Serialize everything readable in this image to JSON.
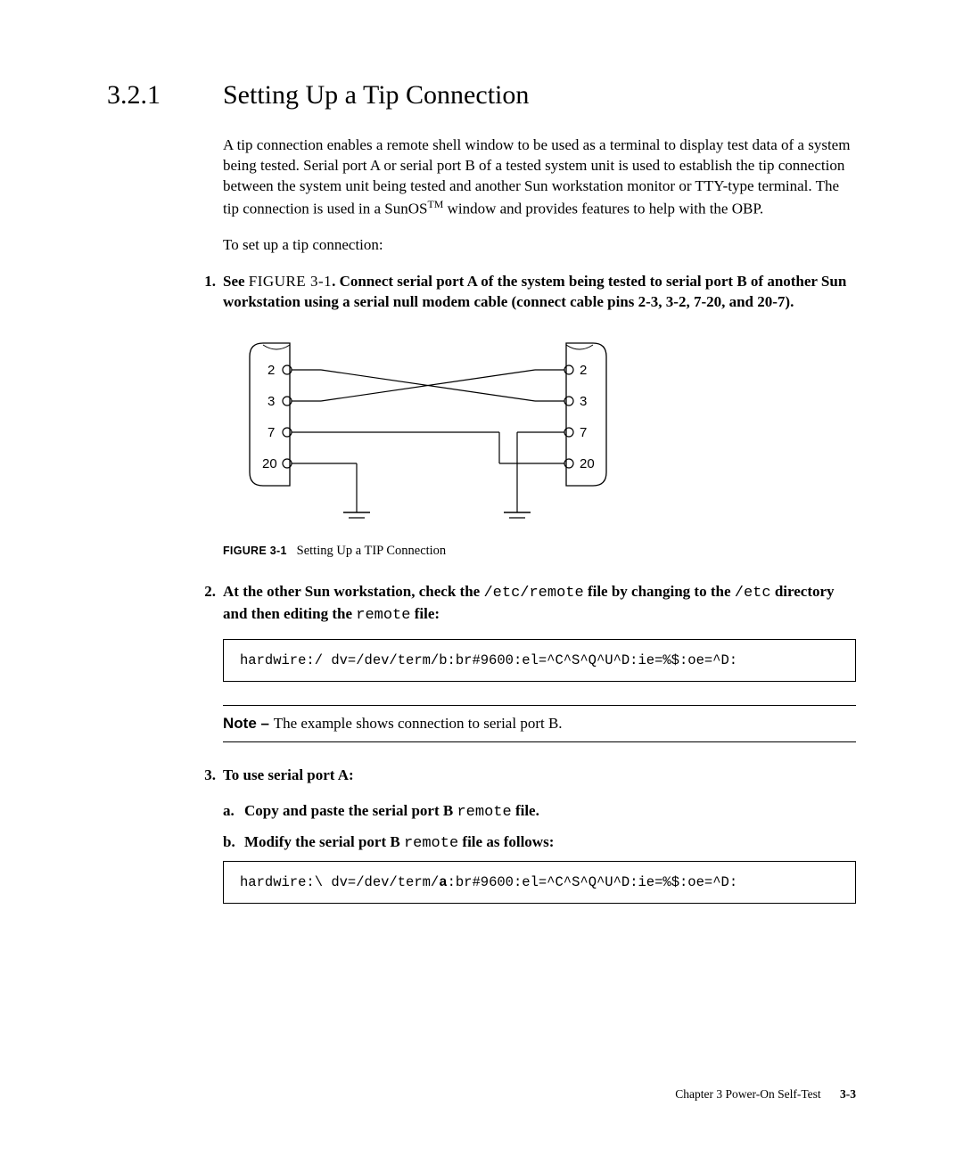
{
  "section": {
    "number": "3.2.1",
    "title": "Setting Up a Tip Connection"
  },
  "intro": {
    "para1a": "A tip connection enables a remote shell window to be used as a terminal to display test data of a system being tested. Serial port A or serial port B of a tested system unit is used to establish the tip connection between the system unit being tested and another Sun workstation monitor or TTY-type terminal. The tip connection is used in a SunOS",
    "para1b": " window and provides features to help with the OBP.",
    "tm": "TM",
    "para2": "To set up a tip connection:"
  },
  "steps": {
    "s1": {
      "num": "1.",
      "lead": "See ",
      "figref": "FIGURE 3-1",
      "rest": ". Connect serial port A of the system being tested to serial port B of another Sun workstation using a serial null modem cable (connect cable pins 2-3, 3-2, 7-20, and 20-7)."
    },
    "s2": {
      "num": "2.",
      "part1": "At the other Sun workstation, check the ",
      "code1": "/etc/remote",
      "part2": " file by changing to the ",
      "code2": "/etc",
      "part3": " directory and then editing the ",
      "code3": "remote",
      "part4": " file:"
    },
    "s3": {
      "num": "3.",
      "text": "To use serial port A:",
      "a_letter": "a.",
      "a_part1": "Copy and paste the serial port B ",
      "a_code": "remote",
      "a_part2": " file.",
      "b_letter": "b.",
      "b_part1": "Modify the serial port B ",
      "b_code": "remote",
      "b_part2": " file as follows:"
    }
  },
  "figure": {
    "labels": {
      "left2": "2",
      "left3": "3",
      "left7": "7",
      "left20": "20",
      "right2": "2",
      "right3": "3",
      "right7": "7",
      "right20": "20"
    },
    "caption_label": "FIGURE 3-1",
    "caption_text": "Setting Up a TIP Connection"
  },
  "code": {
    "block1": "hardwire:/ dv=/dev/term/b:br#9600:el=^C^S^Q^U^D:ie=%$:oe=^D:",
    "block2_pre": "hardwire:\\ dv=/dev/term/",
    "block2_bold": "a",
    "block2_post": ":br#9600:el=^C^S^Q^U^D:ie=%$:oe=^D:"
  },
  "note": {
    "label": "Note – ",
    "text": "The example shows connection to serial port B."
  },
  "footer": {
    "chapter": "Chapter 3    Power-On Self-Test",
    "page": "3-3"
  }
}
